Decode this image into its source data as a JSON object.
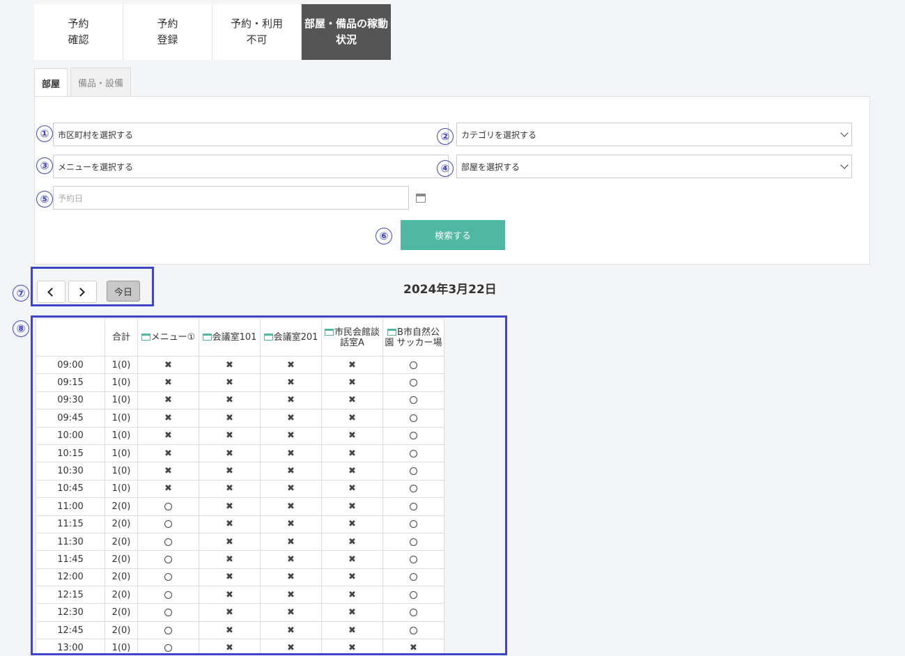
{
  "top_tabs": [
    {
      "label": "予約\n確認",
      "active": false
    },
    {
      "label": "予約\n登録",
      "active": false
    },
    {
      "label": "予約・利用\n不可",
      "active": false
    },
    {
      "label": "部屋・備品の稼動\n状況",
      "active": true
    }
  ],
  "sub_tabs": [
    {
      "label": "部屋",
      "active": true
    },
    {
      "label": "備品・設備",
      "active": false
    }
  ],
  "markers": [
    "①",
    "②",
    "③",
    "④",
    "⑤",
    "⑥",
    "⑦",
    "⑧"
  ],
  "form": {
    "municipality": "市区町村を選択する",
    "category": "カテゴリを選択する",
    "menu": "メニューを選択する",
    "room": "部屋を選択する",
    "date_placeholder": "予約日",
    "search_label": "検索する"
  },
  "nav": {
    "today_label": "今日",
    "current_date": "2024年3月22日"
  },
  "table": {
    "headers": {
      "sum": "合計",
      "rooms": [
        "メニュー①",
        "会議室101",
        "会議室201",
        "市民会館談話室A",
        "B市自然公園 サッカー場"
      ]
    },
    "rows": [
      {
        "time": "09:00",
        "sum": "1(0)",
        "marks": [
          "x",
          "x",
          "x",
          "x",
          "o"
        ]
      },
      {
        "time": "09:15",
        "sum": "1(0)",
        "marks": [
          "x",
          "x",
          "x",
          "x",
          "o"
        ]
      },
      {
        "time": "09:30",
        "sum": "1(0)",
        "marks": [
          "x",
          "x",
          "x",
          "x",
          "o"
        ]
      },
      {
        "time": "09:45",
        "sum": "1(0)",
        "marks": [
          "x",
          "x",
          "x",
          "x",
          "o"
        ]
      },
      {
        "time": "10:00",
        "sum": "1(0)",
        "marks": [
          "x",
          "x",
          "x",
          "x",
          "o"
        ]
      },
      {
        "time": "10:15",
        "sum": "1(0)",
        "marks": [
          "x",
          "x",
          "x",
          "x",
          "o"
        ]
      },
      {
        "time": "10:30",
        "sum": "1(0)",
        "marks": [
          "x",
          "x",
          "x",
          "x",
          "o"
        ]
      },
      {
        "time": "10:45",
        "sum": "1(0)",
        "marks": [
          "x",
          "x",
          "x",
          "x",
          "o"
        ]
      },
      {
        "time": "11:00",
        "sum": "2(0)",
        "marks": [
          "o",
          "x",
          "x",
          "x",
          "o"
        ]
      },
      {
        "time": "11:15",
        "sum": "2(0)",
        "marks": [
          "o",
          "x",
          "x",
          "x",
          "o"
        ]
      },
      {
        "time": "11:30",
        "sum": "2(0)",
        "marks": [
          "o",
          "x",
          "x",
          "x",
          "o"
        ]
      },
      {
        "time": "11:45",
        "sum": "2(0)",
        "marks": [
          "o",
          "x",
          "x",
          "x",
          "o"
        ]
      },
      {
        "time": "12:00",
        "sum": "2(0)",
        "marks": [
          "o",
          "x",
          "x",
          "x",
          "o"
        ]
      },
      {
        "time": "12:15",
        "sum": "2(0)",
        "marks": [
          "o",
          "x",
          "x",
          "x",
          "o"
        ]
      },
      {
        "time": "12:30",
        "sum": "2(0)",
        "marks": [
          "o",
          "x",
          "x",
          "x",
          "o"
        ]
      },
      {
        "time": "12:45",
        "sum": "2(0)",
        "marks": [
          "o",
          "x",
          "x",
          "x",
          "o"
        ]
      },
      {
        "time": "13:00",
        "sum": "1(0)",
        "marks": [
          "o",
          "x",
          "x",
          "x",
          "x"
        ]
      }
    ]
  },
  "colors": {
    "accent_blue": "#3e45c8",
    "search_button": "#4fb8a2",
    "active_tab": "#555555"
  }
}
